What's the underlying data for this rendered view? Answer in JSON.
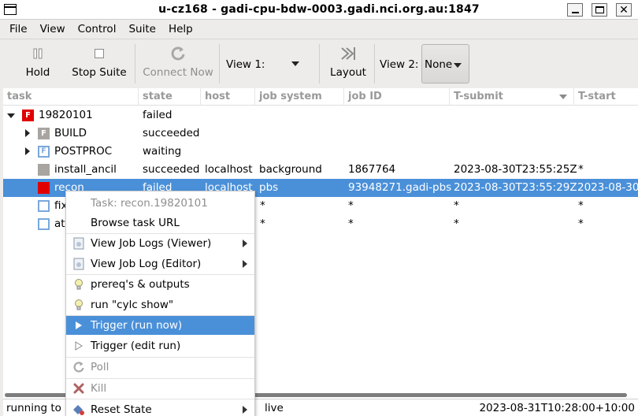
{
  "window": {
    "title": "u-cz168 - gadi-cpu-bdw-0003.gadi.nci.org.au:1847"
  },
  "menubar": [
    "File",
    "View",
    "Control",
    "Suite",
    "Help"
  ],
  "toolbar": {
    "hold": "Hold",
    "stop_suite": "Stop Suite",
    "connect_now": "Connect Now",
    "view1_label": "View 1:",
    "layout": "Layout",
    "view2_label": "View 2:",
    "view2_value": "None"
  },
  "columns": [
    "task",
    "state",
    "host",
    "job system",
    "job ID",
    "T-submit",
    "T-start"
  ],
  "rows": [
    {
      "task": "19820101",
      "badge": "F",
      "state": "failed",
      "host": "",
      "job_system": "",
      "job_id": "",
      "t_submit": "",
      "t_start": ""
    },
    {
      "task": "BUILD",
      "badge": "F",
      "state": "succeeded",
      "host": "",
      "job_system": "",
      "job_id": "",
      "t_submit": "",
      "t_start": ""
    },
    {
      "task": "POSTPROC",
      "badge": "F",
      "state": "waiting",
      "host": "",
      "job_system": "",
      "job_id": "",
      "t_submit": "",
      "t_start": ""
    },
    {
      "task": "install_ancil",
      "badge": "",
      "state": "succeeded",
      "host": "localhost",
      "job_system": "background",
      "job_id": "1867764",
      "t_submit": "2023-08-30T23:55:25Z",
      "t_start": "*"
    },
    {
      "task": "recon",
      "badge": "",
      "state": "failed",
      "host": "localhost",
      "job_system": "pbs",
      "job_id": "93948271.gadi-pbs",
      "t_submit": "2023-08-30T23:55:29Z",
      "t_start": "2023-08-30"
    },
    {
      "task": "fix",
      "badge": "",
      "state": "",
      "host": "",
      "job_system": "*",
      "job_id": "*",
      "t_submit": "*",
      "t_start": "*"
    },
    {
      "task": "at",
      "badge": "",
      "state": "",
      "host": "",
      "job_system": "*",
      "job_id": "*",
      "t_submit": "*",
      "t_start": "*"
    }
  ],
  "context_menu": {
    "header": "Task: recon.19820101",
    "browse": "Browse task URL",
    "view_job_logs": "View Job Logs (Viewer)",
    "view_job_log_editor": "View Job Log (Editor)",
    "prereqs": "prereq's & outputs",
    "run_show": "run \"cylc show\"",
    "trigger_now": "Trigger (run now)",
    "trigger_edit": "Trigger (edit run)",
    "poll": "Poll",
    "kill": "Kill",
    "reset_state": "Reset State"
  },
  "status": {
    "left": "running to s",
    "mid": "live",
    "right": "2023-08-31T10:28:00+10:00"
  },
  "colors": {
    "selection": "#4a90d9",
    "failed": "#e00000",
    "waiting_border": "#7aa8db",
    "succeeded": "#a8a4a0"
  }
}
